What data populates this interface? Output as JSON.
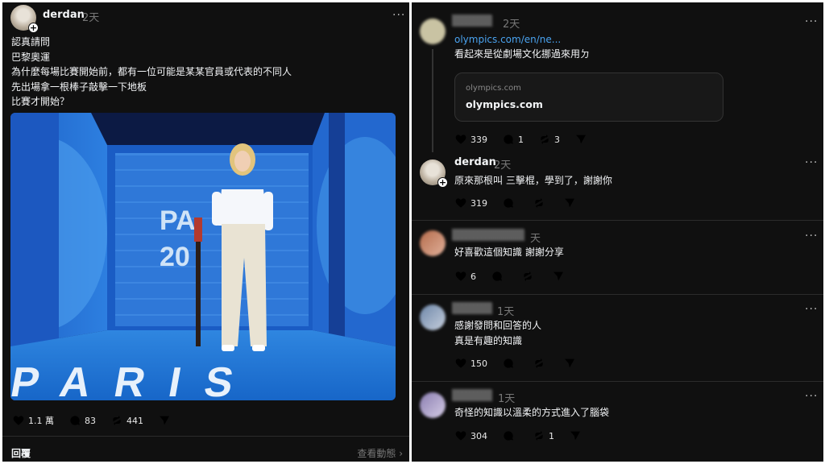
{
  "main_post": {
    "username": "derdan",
    "time": "2天",
    "text": "認真請問\n巴黎奧運\n為什麼每場比賽開始前，都有一位可能是某某官員或代表的不同人\n先出場拿一根棒子敲擊一下地板\n比賽才開始？",
    "image_text_top": "PA",
    "image_text_year": "20",
    "image_text_floor": "PARIS",
    "likes": "1.1 萬",
    "comments": "83",
    "reposts": "441",
    "reply_label": "回覆",
    "view_activity": "查看動態",
    "accent_blue": "#1c78d9"
  },
  "replies": [
    {
      "username": "▒▒▒▒▒",
      "time": "2天",
      "link": "olympics.com/en/ne...",
      "text": "看起來是從劇場文化挪過來用ㄉ",
      "card_domain": "olympics.com",
      "card_title": "olympics.com",
      "likes": "339",
      "comments": "1",
      "reposts": "3"
    },
    {
      "username": "derdan",
      "time": "2天",
      "text": "原來那根叫 三擊棍，學到了，謝謝你",
      "likes": "319"
    },
    {
      "username": "▒▒▒▒▒▒▒▒▒",
      "time": "天",
      "text": "好喜歡這個知識 謝謝分享",
      "likes": "6"
    },
    {
      "username": "▒▒▒▒▒",
      "time": "1天",
      "text": "感謝發問和回答的人\n真是有趣的知識",
      "likes": "150"
    },
    {
      "username": "▒▒▒▒▒",
      "time": "1天",
      "text": "奇怪的知識以溫柔的方式進入了腦袋",
      "likes": "304",
      "reposts": "1"
    }
  ]
}
